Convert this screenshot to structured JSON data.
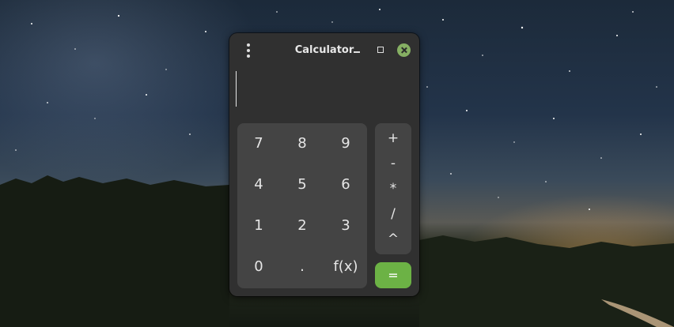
{
  "window": {
    "title": "Calculator"
  },
  "display": {
    "value": ""
  },
  "numpad": {
    "rows": [
      [
        "7",
        "8",
        "9"
      ],
      [
        "4",
        "5",
        "6"
      ],
      [
        "1",
        "2",
        "3"
      ],
      [
        "0",
        ".",
        "f(x)"
      ]
    ]
  },
  "operators": [
    "+",
    "-",
    "*",
    "/",
    "^"
  ],
  "equals": "=",
  "colors": {
    "accent": "#6cb245",
    "close_button": "#86b063",
    "window_bg": "#303030",
    "pad_bg": "#444444"
  },
  "icons": {
    "menu": "vertical-dots-icon",
    "minimize": "minimize-icon",
    "maximize": "maximize-icon",
    "close": "close-icon"
  }
}
